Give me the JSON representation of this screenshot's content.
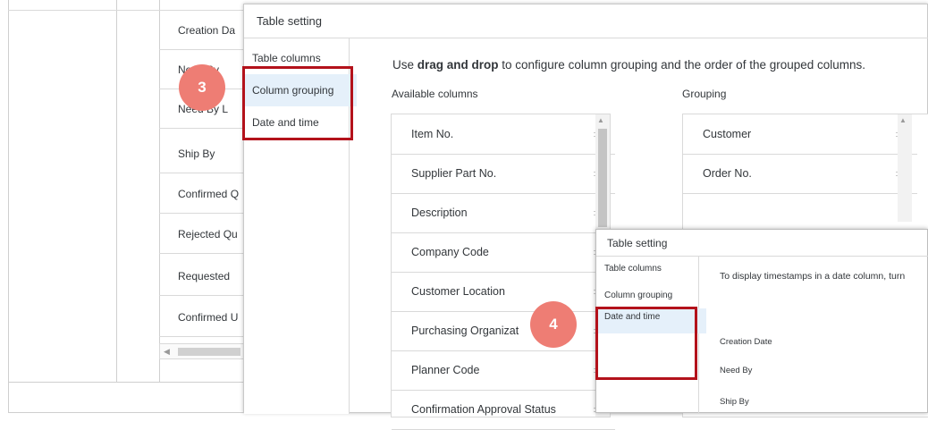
{
  "background": {
    "rows": [
      "Creation Da",
      "Need By",
      "Need By L",
      "Ship By",
      "Confirmed Q",
      "Rejected Qu",
      "Requested",
      "Confirmed U"
    ]
  },
  "dialog1": {
    "title": "Table setting",
    "nav": [
      {
        "label": "Table columns",
        "selected": false
      },
      {
        "label": "Column grouping",
        "selected": true
      },
      {
        "label": "Date and time",
        "selected": false
      }
    ],
    "intro_pre": "Use ",
    "intro_bold": "drag and drop",
    "intro_post": " to configure column grouping and the order of the grouped columns.",
    "available_label": "Available columns",
    "grouping_label": "Grouping",
    "available_columns": [
      "Item No.",
      "Supplier Part No.",
      "Description",
      "Company Code",
      "Customer Location",
      "Purchasing Organizat",
      "Planner Code",
      "Confirmation Approval Status"
    ],
    "grouping_columns": [
      "Customer",
      "Order No."
    ]
  },
  "dialog2": {
    "title": "Table setting",
    "nav": [
      {
        "label": "Table columns",
        "selected": false
      },
      {
        "label": "Column grouping",
        "selected": false
      },
      {
        "label": "Date and time",
        "selected": true
      }
    ],
    "description": "To display timestamps in a date column, turn",
    "fields": [
      "Creation Date",
      "Need By",
      "Ship By"
    ]
  },
  "annotations": {
    "badge_3": "3",
    "badge_4": "4",
    "highlight_color": "#b3121b",
    "badge_color": "#ee7d74"
  }
}
